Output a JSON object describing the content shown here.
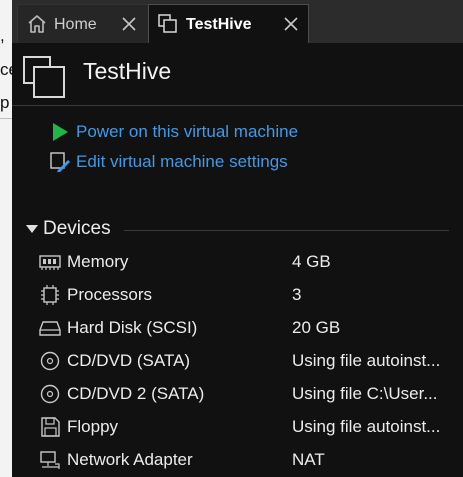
{
  "tabs": [
    {
      "label": "Home",
      "icon": "home-icon",
      "active": false
    },
    {
      "label": "TestHive",
      "icon": "vm-icon",
      "active": true
    }
  ],
  "background_fragments": [
    ",",
    "ce",
    "p"
  ],
  "vm": {
    "title": "TestHive",
    "actions": [
      {
        "label": "Power on this virtual machine",
        "icon": "play-icon"
      },
      {
        "label": "Edit virtual machine settings",
        "icon": "edit-settings-icon"
      }
    ]
  },
  "devices": {
    "header": "Devices",
    "items": [
      {
        "name": "Memory",
        "value": "4 GB",
        "icon": "memory-icon"
      },
      {
        "name": "Processors",
        "value": "3",
        "icon": "processor-icon"
      },
      {
        "name": "Hard Disk (SCSI)",
        "value": "20 GB",
        "icon": "hard-disk-icon"
      },
      {
        "name": "CD/DVD (SATA)",
        "value": "Using file autoinst...",
        "icon": "cd-dvd-icon"
      },
      {
        "name": "CD/DVD 2 (SATA)",
        "value": "Using file C:\\User...",
        "icon": "cd-dvd-icon"
      },
      {
        "name": "Floppy",
        "value": "Using file autoinst...",
        "icon": "floppy-icon"
      },
      {
        "name": "Network Adapter",
        "value": "NAT",
        "icon": "network-adapter-icon"
      }
    ]
  },
  "colors": {
    "accent_link": "#3d9be9",
    "play_green": "#1fb74a",
    "background": "#111111",
    "tabbar": "#2c2c2c"
  }
}
